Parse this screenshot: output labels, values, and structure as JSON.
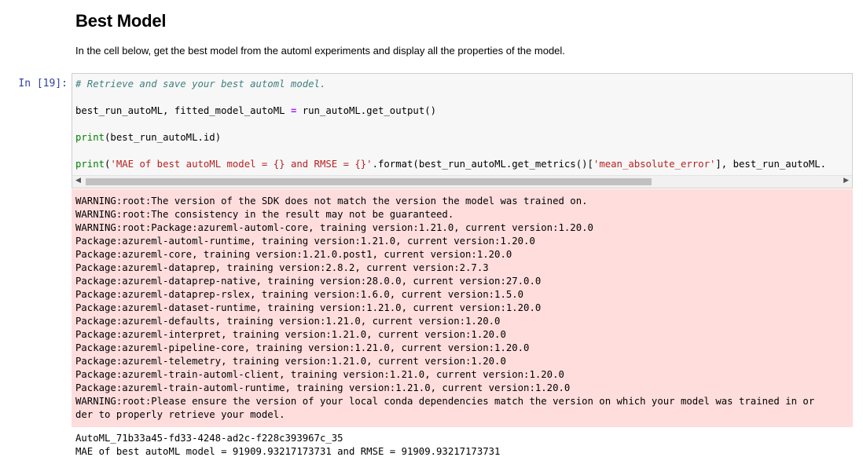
{
  "markdown": {
    "heading": "Best Model",
    "paragraph": "In the cell below, get the best model from the automl experiments and display all the properties of the model."
  },
  "cell": {
    "prompt": "In [19]:",
    "code": {
      "comment": "# Retrieve and save your best automl model.",
      "line2_lhs": "best_run_autoML, fitted_model_autoML ",
      "line2_op": "=",
      "line2_rhs": " run_autoML.get_output()",
      "line3_fn": "print",
      "line3_rest": "(best_run_autoML.id)",
      "line4_fn": "print",
      "line4_open": "(",
      "line4_str1": "'MAE of best autoML model = {} and RMSE = {}'",
      "line4_mid": ".format(best_run_autoML.get_metrics()[",
      "line4_str2": "'mean_absolute_error'",
      "line4_tail": "], best_run_autoML."
    },
    "scrollbar": {
      "left_arrow": "◀",
      "right_arrow": "▶"
    }
  },
  "stderr": [
    "WARNING:root:The version of the SDK does not match the version the model was trained on.",
    "WARNING:root:The consistency in the result may not be guaranteed.",
    "WARNING:root:Package:azureml-automl-core, training version:1.21.0, current version:1.20.0",
    "Package:azureml-automl-runtime, training version:1.21.0, current version:1.20.0",
    "Package:azureml-core, training version:1.21.0.post1, current version:1.20.0",
    "Package:azureml-dataprep, training version:2.8.2, current version:2.7.3",
    "Package:azureml-dataprep-native, training version:28.0.0, current version:27.0.0",
    "Package:azureml-dataprep-rslex, training version:1.6.0, current version:1.5.0",
    "Package:azureml-dataset-runtime, training version:1.21.0, current version:1.20.0",
    "Package:azureml-defaults, training version:1.21.0, current version:1.20.0",
    "Package:azureml-interpret, training version:1.21.0, current version:1.20.0",
    "Package:azureml-pipeline-core, training version:1.21.0, current version:1.20.0",
    "Package:azureml-telemetry, training version:1.21.0, current version:1.20.0",
    "Package:azureml-train-automl-client, training version:1.21.0, current version:1.20.0",
    "Package:azureml-train-automl-runtime, training version:1.21.0, current version:1.20.0",
    "WARNING:root:Please ensure the version of your local conda dependencies match the version on which your model was trained in or",
    "der to properly retrieve your model."
  ],
  "stdout": [
    "AutoML_71b33a45-fd33-4248-ad2c-f228c393967c_35",
    "MAE of best autoML model = 91909.93217173731 and RMSE = 91909.93217173731"
  ]
}
